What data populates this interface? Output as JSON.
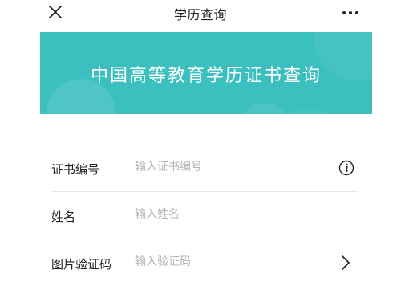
{
  "nav": {
    "title": "学历查询",
    "close_icon": "close-icon",
    "more_icon": "more-icon"
  },
  "banner": {
    "title": "中国高等教育学历证书查询",
    "background_color": "#3bbfbf"
  },
  "form": {
    "fields": [
      {
        "label": "证书编号",
        "placeholder": "输入证书编号",
        "icon": "info-icon"
      },
      {
        "label": "姓名",
        "placeholder": "输入姓名"
      },
      {
        "label": "图片验证码",
        "placeholder": "输入验证码",
        "icon": "chevron-right-icon"
      }
    ]
  }
}
